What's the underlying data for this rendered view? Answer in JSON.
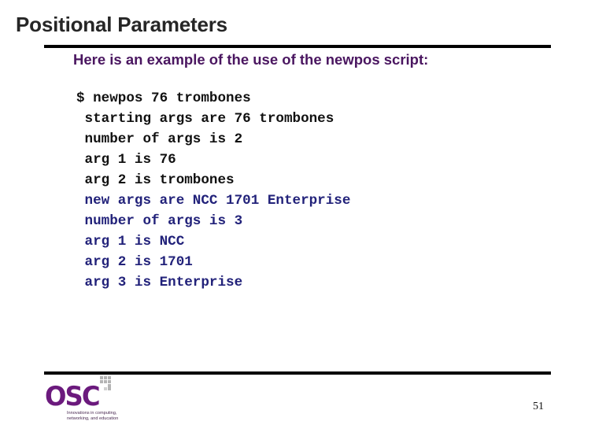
{
  "slide": {
    "title": "Positional Parameters",
    "subtitle": "Here is an example of the use of the newpos script:",
    "page_number": "51"
  },
  "code_block": {
    "lines": [
      {
        "text": "$ newpos 76 trombones",
        "color": "#111111"
      },
      {
        "text": " starting args are 76 trombones",
        "color": "#111111"
      },
      {
        "text": " number of args is 2",
        "color": "#111111"
      },
      {
        "text": " arg 1 is 76",
        "color": "#111111"
      },
      {
        "text": " arg 2 is trombones",
        "color": "#111111"
      },
      {
        "text": " new args are NCC 1701 Enterprise",
        "color": "#22227a"
      },
      {
        "text": " number of args is 3",
        "color": "#22227a"
      },
      {
        "text": " arg 1 is NCC",
        "color": "#22227a"
      },
      {
        "text": " arg 2 is 1701",
        "color": "#22227a"
      },
      {
        "text": " arg 3 is Enterprise",
        "color": "#22227a"
      }
    ]
  },
  "logo": {
    "name": "OSC",
    "tagline_line1": "Innovations in computing,",
    "tagline_line2": "networking, and education",
    "brand_color": "#6b1a7d"
  }
}
